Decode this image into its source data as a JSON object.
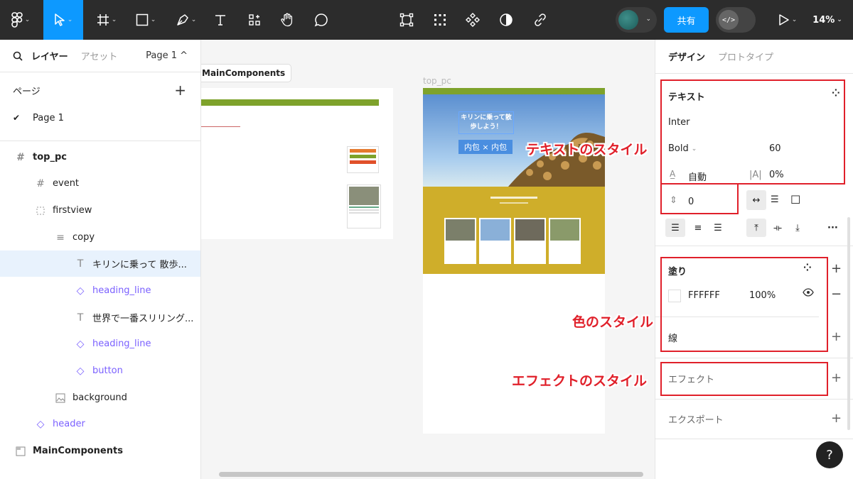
{
  "toolbar": {
    "share_label": "共有",
    "dev_label": "</>",
    "zoom": "14%"
  },
  "left_panel": {
    "tab_layers": "レイヤー",
    "tab_assets": "アセット",
    "page_selector": "Page 1 ^",
    "pages_heading": "ページ",
    "page_item": "Page 1",
    "layers": [
      {
        "label": "top_pc",
        "kind": "frame"
      },
      {
        "label": "event",
        "kind": "frame"
      },
      {
        "label": "firstview",
        "kind": "group"
      },
      {
        "label": "copy",
        "kind": "autolayout"
      },
      {
        "label": "キリンに乗って 散歩...",
        "kind": "text"
      },
      {
        "label": "heading_line",
        "kind": "instance"
      },
      {
        "label": "世界で一番スリリング...",
        "kind": "text"
      },
      {
        "label": "heading_line",
        "kind": "instance"
      },
      {
        "label": "button",
        "kind": "instance"
      },
      {
        "label": "background",
        "kind": "image"
      },
      {
        "label": "header",
        "kind": "instance"
      },
      {
        "label": "MainComponents",
        "kind": "section"
      }
    ]
  },
  "canvas": {
    "maincomponents_label": "MainComponents",
    "frame_label": "top_pc",
    "hero_text": "キリンに乗って散歩しよう！",
    "hero_button": "内包 × 内包"
  },
  "right_panel": {
    "tab_design": "デザイン",
    "tab_prototype": "プロトタイプ",
    "text_section": {
      "title": "テキスト",
      "font_family": "Inter",
      "font_weight": "Bold",
      "font_size": "60",
      "line_height": "自動",
      "letter_spacing": "0%",
      "paragraph_spacing": "0"
    },
    "fill_section": {
      "title": "塗り",
      "color_hex": "FFFFFF",
      "opacity": "100%"
    },
    "stroke_label": "線",
    "effects_label": "エフェクト",
    "export_label": "エクスポート",
    "help": "?"
  },
  "annotations": {
    "text_style": "テキストのスタイル",
    "color_style": "色のスタイル",
    "effect_style": "エフェクトのスタイル"
  },
  "colors": {
    "accent": "#0d99ff",
    "component": "#7b61ff",
    "annotation_red": "#e0202a",
    "toolbar_bg": "#2c2c2c"
  }
}
